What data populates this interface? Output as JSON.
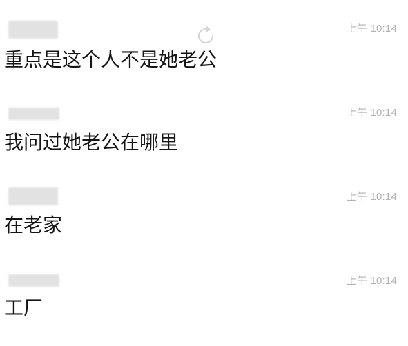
{
  "messages": [
    {
      "time": "上午 10:14",
      "text": "重点是这个人不是她老公"
    },
    {
      "time": "上午 10:14",
      "text": "我问过她老公在哪里"
    },
    {
      "time": "上午 10:14",
      "text": "在老家"
    },
    {
      "time": "上午 10:14",
      "text": "工厂"
    }
  ],
  "colors": {
    "text": "#141414",
    "timestamp": "#b3b3b3",
    "redacted_name": "#e2e2e2",
    "background": "#ffffff"
  },
  "icons": [
    "refresh-icon"
  ]
}
